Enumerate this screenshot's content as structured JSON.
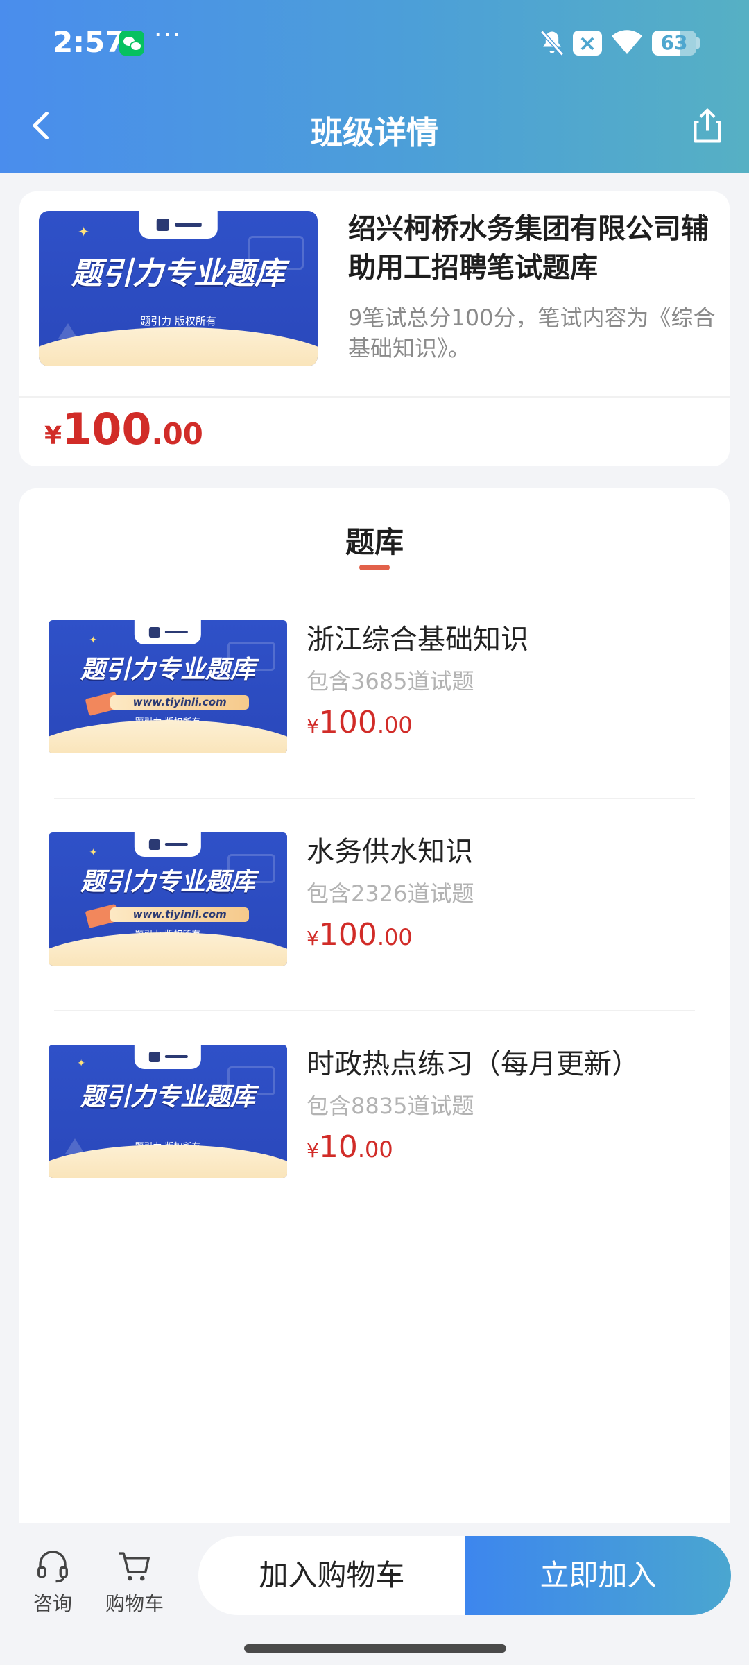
{
  "status_bar": {
    "time": "2:57",
    "more": "···",
    "battery_level": 63,
    "battery_text": "63",
    "icons": [
      "wechat-icon",
      "bell-off-icon",
      "close-badge-icon",
      "wifi-icon",
      "battery-icon"
    ]
  },
  "nav": {
    "title": "班级详情",
    "back_icon": "chevron-left-icon",
    "share_icon": "share-icon"
  },
  "course": {
    "title": "绍兴柯桥水务集团有限公司辅助用工招聘笔试题库",
    "description": "9笔试总分100分，笔试内容为《综合基础知识》。",
    "price": {
      "currency": "¥",
      "integer": "100",
      "decimal": ".00"
    },
    "thumbnail": {
      "banner_title": "题引力专业题库",
      "copyright": "题引力 版权所有"
    }
  },
  "question_bank": {
    "heading": "题库",
    "items": [
      {
        "name": "浙江综合基础知识",
        "count": "包含3685道试题",
        "price": {
          "currency": "¥",
          "integer": "100",
          "decimal": ".00"
        },
        "thumbnail": {
          "banner_title": "题引力专业题库",
          "url": "www.tiyinli.com",
          "copyright": "题引力 版权所有"
        }
      },
      {
        "name": "水务供水知识",
        "count": "包含2326道试题",
        "price": {
          "currency": "¥",
          "integer": "100",
          "decimal": ".00"
        },
        "thumbnail": {
          "banner_title": "题引力专业题库",
          "url": "www.tiyinli.com",
          "copyright": "题引力 版权所有"
        }
      },
      {
        "name": "时政热点练习（每月更新）",
        "count": "包含8835道试题",
        "price": {
          "currency": "¥",
          "integer": "10",
          "decimal": ".00"
        },
        "thumbnail": {
          "banner_title": "题引力专业题库",
          "copyright": "题引力 版权所有"
        }
      }
    ]
  },
  "bottom_bar": {
    "consult_label": "咨询",
    "cart_label": "购物车",
    "add_to_cart_label": "加入购物车",
    "join_now_label": "立即加入"
  },
  "colors": {
    "header_start": "#4a8ded",
    "header_end": "#56b0c4",
    "price_red": "#d12c28",
    "heading_underline": "#e2614a",
    "join_button": "#3d86ee"
  }
}
